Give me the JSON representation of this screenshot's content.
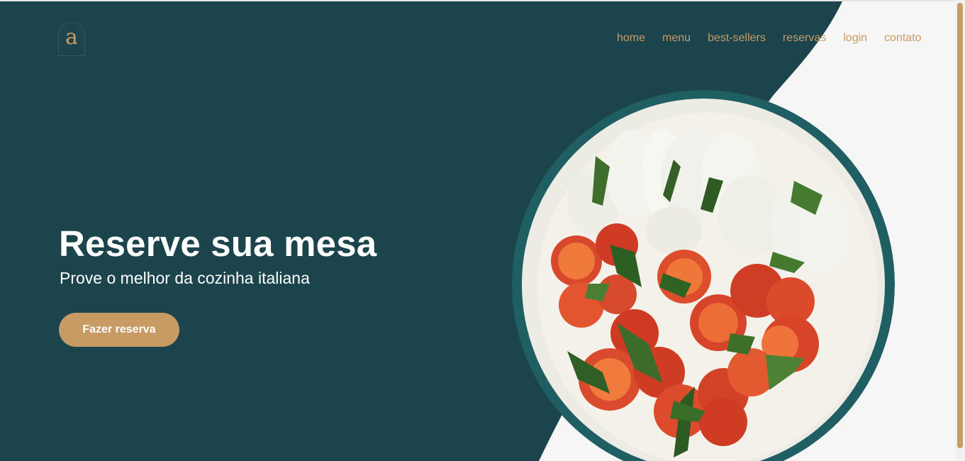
{
  "brand": {
    "logo_letter": "a"
  },
  "nav": {
    "items": [
      "home",
      "menu",
      "best-sellers",
      "reservas",
      "login",
      "contato"
    ]
  },
  "hero": {
    "title": "Reserve sua mesa",
    "subtitle": "Prove o melhor da cozinha italiana",
    "cta_label": "Fazer reserva"
  },
  "colors": {
    "primary_dark": "#1c444d",
    "accent": "#c89a64",
    "background_light": "#f6f6f6",
    "text_light": "#ffffff"
  }
}
